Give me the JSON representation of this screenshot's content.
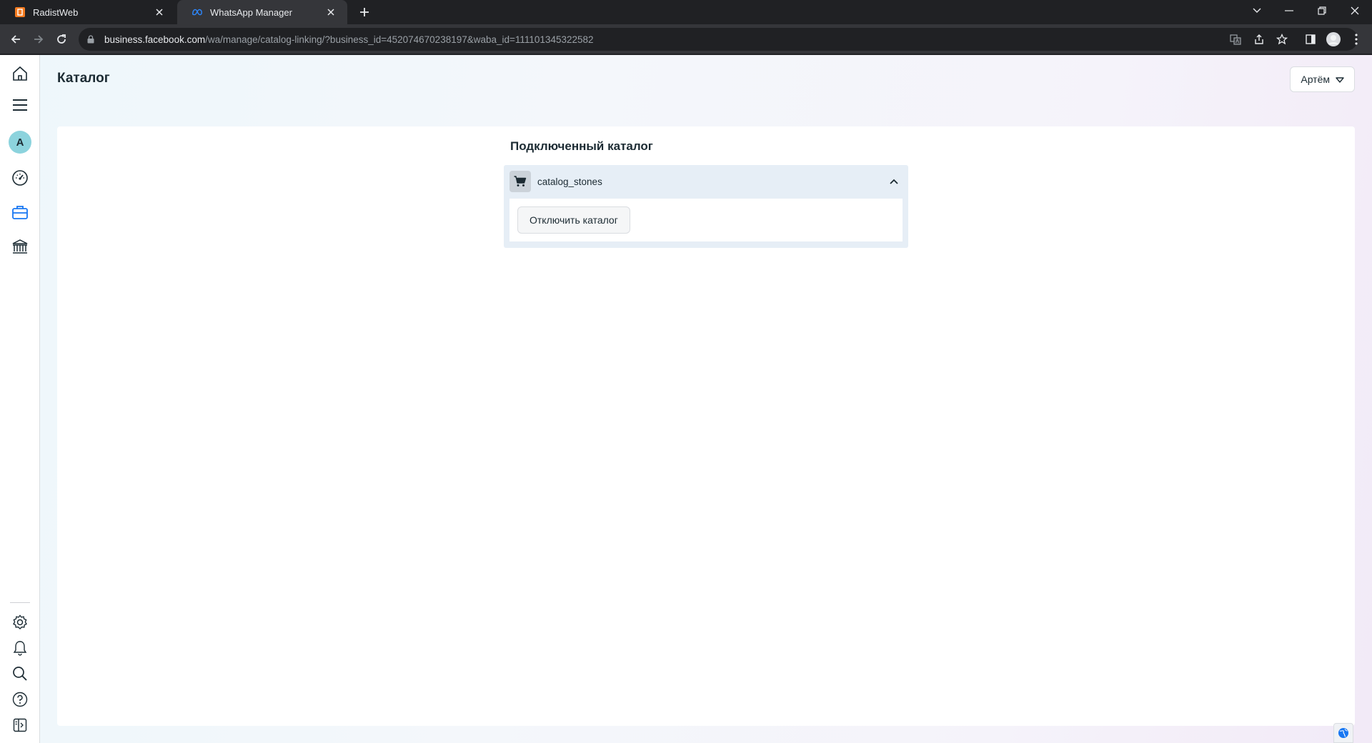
{
  "browser": {
    "tabs": [
      {
        "title": "RadistWeb",
        "favicon": "radistweb-logo",
        "active": false
      },
      {
        "title": "WhatsApp Manager",
        "favicon": "meta-logo",
        "active": true
      }
    ],
    "url": {
      "domain": "business.facebook.com",
      "path": "/wa/manage/catalog-linking/?business_id=452074670238197&waba_id=111101345322582"
    },
    "accent": "#202124"
  },
  "sidebar": {
    "avatar_letter": "A",
    "avatar_color": "#8cd3dd",
    "active_color": "#1877f2",
    "items": [
      "home-icon",
      "menu-icon",
      "dashboard-icon",
      "briefcase-icon",
      "bank-icon",
      "settings-icon",
      "bell-icon",
      "search-icon",
      "help-icon",
      "panel-icon"
    ]
  },
  "header": {
    "title": "Каталог",
    "account_name": "Артём"
  },
  "main": {
    "section_title": "Подключенный каталог",
    "catalog": {
      "name": "catalog_stones",
      "expanded": true,
      "disconnect_label": "Отключить каталог"
    }
  }
}
